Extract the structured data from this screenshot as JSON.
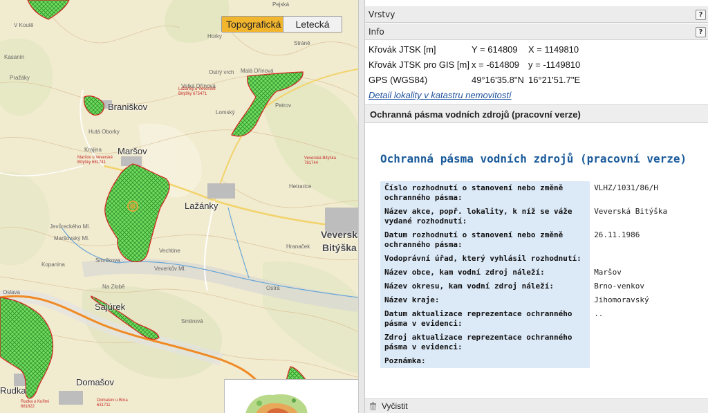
{
  "map": {
    "tabs": [
      {
        "label": "Topografická",
        "active": true
      },
      {
        "label": "Letecká",
        "active": false
      }
    ],
    "places_major": [
      "Braniškov",
      "Maršov",
      "Lažánky",
      "Veverská",
      "Bitýška",
      "Sajúrek",
      "Domašov",
      "Rudka"
    ],
    "places_minor": [
      "Kasanín",
      "Hutá Oborky",
      "Krajina",
      "Ostrý vrch",
      "Malá Dřínová",
      "Velká Dřínová",
      "Lomský",
      "Petrov",
      "Hetrarice",
      "Vechtine",
      "Hranaček",
      "Ostrá",
      "Smrčkova",
      "Veverkův Ml.",
      "Jevůreckého Ml.",
      "Maršovský Ml.",
      "Kopanina",
      "Smitrová",
      "Pejská",
      "Stráně",
      "Horky",
      "Pražáky",
      "Na Zlobě",
      "Oslava",
      "V Koutě"
    ],
    "places_red": [
      "Lažánky u Veverské Bítýšky 675471",
      "Maršov u Veverské Bítýšky 681741",
      "Veverská Bítýška 781744",
      "Rudka u Kuřimi 681822",
      "Domašov u Brna 631711"
    ],
    "colors": {
      "protection_fill": "#53d14e",
      "protection_outline": "#d62020",
      "marker": "#e6a33a"
    }
  },
  "panel": {
    "layers_label": "Vrstvy",
    "info_label": "Info",
    "help_glyph": "?",
    "coords": [
      {
        "label": "Křovák JTSK [m]",
        "a": "Y = 614809",
        "b": "X = 1149810"
      },
      {
        "label": "Křovák JTSK pro GIS [m]",
        "a": "x = -614809",
        "b": "y = -1149810"
      },
      {
        "label": "GPS (WGS84)",
        "a": "49°16'35.8\"N",
        "b": "16°21'51.7\"E"
      }
    ],
    "detail_link": "Detail lokality v katastru nemovitostí",
    "section_title": "Ochranná pásma vodních zdrojů (pracovní verze)",
    "info_title": "Ochranná pásma vodních zdrojů (pracovní verze)",
    "attributes": [
      {
        "key": "Číslo rozhodnutí o stanovení nebo změně ochranného pásma:",
        "value": "VLHZ/1031/86/H"
      },
      {
        "key": "Název akce, popř. lokality, k níž se váže vydané rozhodnutí:",
        "value": "Veverská Bitýška"
      },
      {
        "key": "Datum rozhodnutí o stanovení nebo změně ochranného pásma:",
        "value": "26.11.1986"
      },
      {
        "key": "Vodoprávní úřad, který vyhlásil rozhodnutí:",
        "value": ""
      },
      {
        "key": "Název obce, kam vodní zdroj náleží:",
        "value": "Maršov"
      },
      {
        "key": "Název okresu, kam vodní zdroj náleží:",
        "value": "Brno-venkov"
      },
      {
        "key": "Název kraje:",
        "value": "Jihomoravský"
      },
      {
        "key": "Datum aktualizace reprezentace ochranného pásma v evidenci:",
        "value": ".."
      },
      {
        "key": "Zdroj aktualizace reprezentace ochranného pásma v evidenci:",
        "value": ""
      },
      {
        "key": "Poznámka:",
        "value": ""
      }
    ],
    "clear_label": "Vyčistit"
  }
}
